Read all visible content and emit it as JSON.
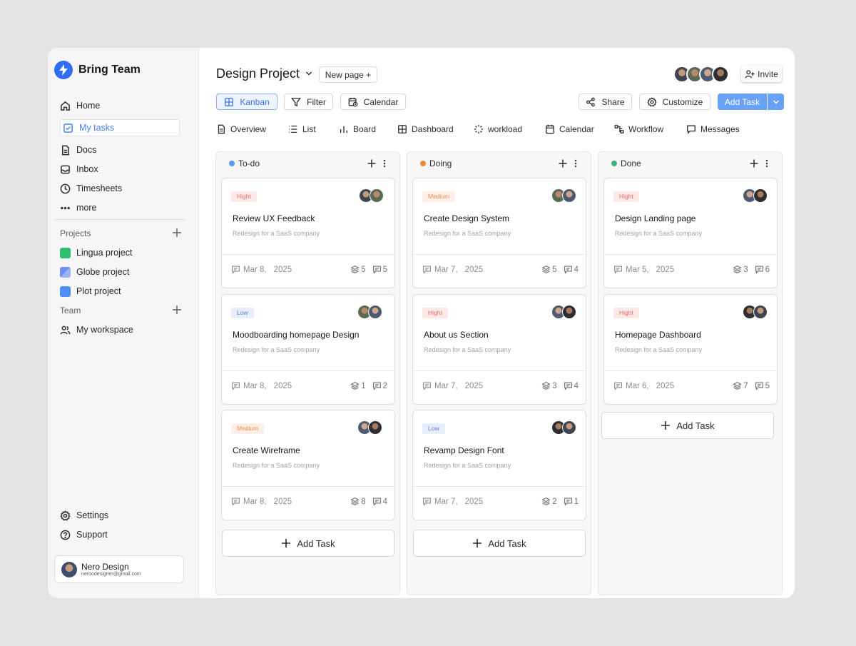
{
  "brand": {
    "name": "Bring Team",
    "accent": "#2f6df6"
  },
  "sidebar": {
    "nav": [
      {
        "label": "Home",
        "icon": "home-icon"
      },
      {
        "label": "My tasks",
        "icon": "checkbox-icon",
        "active": true
      },
      {
        "label": "Docs",
        "icon": "document-icon"
      },
      {
        "label": "Inbox",
        "icon": "inbox-icon"
      },
      {
        "label": "Timesheets",
        "icon": "clock-icon"
      },
      {
        "label": "more",
        "icon": "more-icon"
      }
    ],
    "projects_title": "Projects",
    "projects": [
      {
        "label": "Lingua project",
        "color": "#2fbf72"
      },
      {
        "label": "Globe project",
        "color": "#6e8ef2"
      },
      {
        "label": "Plot project",
        "color": "#4f8ef5"
      }
    ],
    "team_title": "Team",
    "team": [
      {
        "label": "My workspace",
        "icon": "users-icon"
      }
    ],
    "bottom": [
      {
        "label": "Settings",
        "icon": "gear-icon"
      },
      {
        "label": "Support",
        "icon": "help-icon"
      }
    ],
    "user": {
      "name": "Nero Design",
      "email": "neroodesigner@gmail.com"
    }
  },
  "header": {
    "title": "Design Project",
    "new_page": "New page +",
    "invite": "Invite"
  },
  "toolbar": {
    "kanban": "Kanban",
    "filter": "Filter",
    "calendar": "Calendar",
    "share": "Share",
    "customize": "Customize",
    "add_task": "Add Task"
  },
  "tabs": [
    {
      "label": "Overview",
      "icon": "document-icon"
    },
    {
      "label": "List",
      "icon": "list-icon"
    },
    {
      "label": "Board",
      "icon": "bar-chart-icon"
    },
    {
      "label": "Dashboard",
      "icon": "grid-icon"
    },
    {
      "label": "workload",
      "icon": "loader-icon"
    },
    {
      "label": "Calendar",
      "icon": "calendar-icon"
    },
    {
      "label": "Workflow",
      "icon": "workflow-icon"
    },
    {
      "label": "Messages",
      "icon": "message-icon"
    }
  ],
  "columns": [
    {
      "name": "To-do",
      "color": "#5b9bf0",
      "cards": [
        {
          "priority": "Hight",
          "level": "high",
          "title": "Review UX Feedback",
          "subtitle": "Redesign for a SaaS company",
          "date": "Mar 8,",
          "year": "2025",
          "layers": "5",
          "comments": "5"
        },
        {
          "priority": "Low",
          "level": "low",
          "title": "Moodboarding homepage Design",
          "subtitle": "Redesign for a SaaS company",
          "date": "Mar 8,",
          "year": "2025",
          "layers": "1",
          "comments": "2"
        },
        {
          "priority": "Medium",
          "level": "medium",
          "title": "Create Wireframe",
          "subtitle": "Redesign for a SaaS company",
          "date": "Mar 8,",
          "year": "2025",
          "layers": "8",
          "comments": "4"
        }
      ],
      "add_label": "Add Task"
    },
    {
      "name": "Doing",
      "color": "#f08a3c",
      "cards": [
        {
          "priority": "Medium",
          "level": "medium",
          "title": "Create Design System",
          "subtitle": "Redesign for a SaaS company",
          "date": "Mar 7,",
          "year": "2025",
          "layers": "5",
          "comments": "4"
        },
        {
          "priority": "Hight",
          "level": "high",
          "title": "About us Section",
          "subtitle": "Redesign for a SaaS company",
          "date": "Mar 7,",
          "year": "2025",
          "layers": "3",
          "comments": "4"
        },
        {
          "priority": "Low",
          "level": "low",
          "title": "Revamp Design Font",
          "subtitle": "Redesign for a SaaS company",
          "date": "Mar 7,",
          "year": "2025",
          "layers": "2",
          "comments": "1"
        }
      ],
      "add_label": "Add Task"
    },
    {
      "name": "Done",
      "color": "#3fb07c",
      "cards": [
        {
          "priority": "Hight",
          "level": "high",
          "title": "Design Landing page",
          "subtitle": "Redesign for a SaaS company",
          "date": "Mar 5,",
          "year": "2025",
          "layers": "3",
          "comments": "6"
        },
        {
          "priority": "Hight",
          "level": "high",
          "title": "Homepage Dashboard",
          "subtitle": "Redesign for a SaaS company",
          "date": "Mar 6,",
          "year": "2025",
          "layers": "7",
          "comments": "5"
        }
      ],
      "add_label": "Add Task"
    }
  ]
}
